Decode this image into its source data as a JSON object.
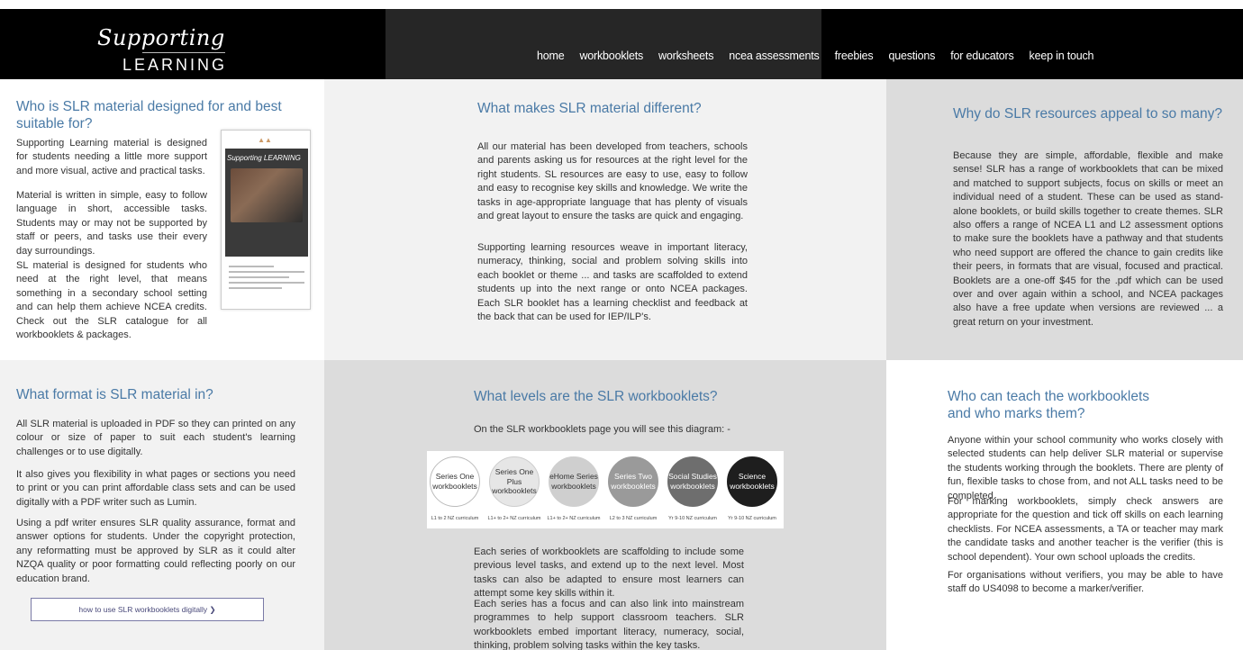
{
  "brand": {
    "script": "Supporting",
    "block": "LEARNING"
  },
  "nav": [
    "home",
    "workbooklets",
    "worksheets",
    "ncea assessments",
    "freebies",
    "questions",
    "for educators",
    "keep in touch"
  ],
  "sections": {
    "who": {
      "title": "Who is SLR material designed for and best suitable for?",
      "p1": "Supporting Learning material is designed for students needing a little more support and more visual, active and practical tasks.",
      "p2": "Material is written in simple, easy to follow language in short, accessible tasks. Students may or may not be supported by staff or peers, and tasks use their every day surroundings.",
      "p3": "SL material is designed for students who need at the right level, that means something in a secondary school setting and can help them achieve NCEA credits. Check out the SLR catalogue for all workbooklets & packages.",
      "catalog_title": "Supporting LEARNING"
    },
    "different": {
      "title": "What makes SLR material different?",
      "p1": "All our material has been developed from teachers, schools and parents asking us for resources at the right level for the right students. SL resources are easy to use, easy to follow and easy to recognise key skills and knowledge. We write the tasks in age-appropriate language that has plenty of visuals and great layout to ensure the tasks are quick and engaging.",
      "p2": "Supporting learning resources weave in important literacy, numeracy, thinking, social and problem solving skills into each booklet or theme ... and tasks are scaffolded to extend students up into the next range or onto NCEA packages. Each SLR booklet has a learning checklist and feedback at the back that can be used for IEP/ILP's."
    },
    "appeal": {
      "title": "Why do SLR resources appeal to so many?",
      "p1": "Because they are simple, affordable, flexible and make sense! SLR has a range of workbooklets that can be mixed and matched to support subjects, focus on skills or meet an individual need of a student. These can be used as stand-alone booklets, or build skills together to create themes. SLR also offers a range of NCEA L1 and L2 assessment options to make sure the booklets have a pathway and that students who need support are offered the chance to gain credits like their peers, in formats that are visual, focused and practical. Booklets are a one-off $45 for the .pdf which can be used over and over again within a school, and NCEA packages also have a free update when versions are reviewed ... a great return on your investment."
    },
    "format": {
      "title": "What format is SLR material in?",
      "p1": "All SLR material is uploaded in PDF so they can printed on any colour or size of paper to suit each student's learning challenges or to use digitally.",
      "p2": "It also gives you flexibility in what pages or sections you need to print or you can print affordable class sets and can be used digitally with a PDF writer such as Lumin.",
      "p3": "Using a pdf writer ensures SLR quality assurance, format and answer options for students. Under the copyright protection, any reformatting must be approved by SLR as it could alter NZQA quality or poor formatting could reflecting poorly on our education brand.",
      "button": "how to use SLR workbooklets digitally ❯"
    },
    "levels": {
      "title": "What levels are the SLR workbooklets?",
      "intro": "On the SLR workbooklets page you will see this diagram: -",
      "series": [
        {
          "label": "Series One workbooklets",
          "caption": "L1 to 2 NZ curriculum",
          "bg": "#ffffff",
          "fg": "#333333",
          "border": "#bbbbbb"
        },
        {
          "label": "Series One Plus workbooklets",
          "caption": "L1+ to 2+ NZ curriculum",
          "bg": "#e6e6e6",
          "fg": "#333333",
          "border": "#cccccc"
        },
        {
          "label": "eHome Series workbooklets",
          "caption": "L1+ to 2+ NZ curriculum",
          "bg": "#cfcfcf",
          "fg": "#333333",
          "border": "#cfcfcf"
        },
        {
          "label": "Series Two workbooklets",
          "caption": "L2 to 3 NZ curriculum",
          "bg": "#9a9a9a",
          "fg": "#ffffff",
          "border": "#9a9a9a"
        },
        {
          "label": "Social Studies workbooklets",
          "caption": "Yr 9-10 NZ curriculum",
          "bg": "#6e6e6e",
          "fg": "#ffffff",
          "border": "#6e6e6e"
        },
        {
          "label": "Science workbooklets",
          "caption": "Yr 9-10 NZ curriculum",
          "bg": "#1e1e1e",
          "fg": "#ffffff",
          "border": "#1e1e1e"
        }
      ],
      "p1": "Each series of workbooklets are scaffolding to include some previous level tasks, and extend up to the next level. Most tasks can also be adapted to ensure most learners can attempt some key skills within it.",
      "p2": "Each series has a focus and can also link into mainstream programmes to help support classroom teachers. SLR workbooklets embed important literacy, numeracy, social, thinking, problem solving tasks within the key tasks."
    },
    "teach": {
      "title": "Who can teach the workbooklets and who marks them?",
      "p1": "Anyone within your school community who works closely with selected students can help deliver SLR material or supervise the students working through the booklets. There are plenty of fun, flexible tasks to chose from, and not ALL tasks need to be completed.",
      "p2": "For marking workbooklets, simply check answers are appropriate for the question and tick off skills on each learning checklists. For NCEA assessments, a TA or teacher may mark the candidate tasks and another teacher is the verifier (this is school dependent). Your own school uploads the credits.",
      "p3": "For organisations without verifiers, you may be able to have staff do US4098 to become a marker/verifier."
    }
  }
}
